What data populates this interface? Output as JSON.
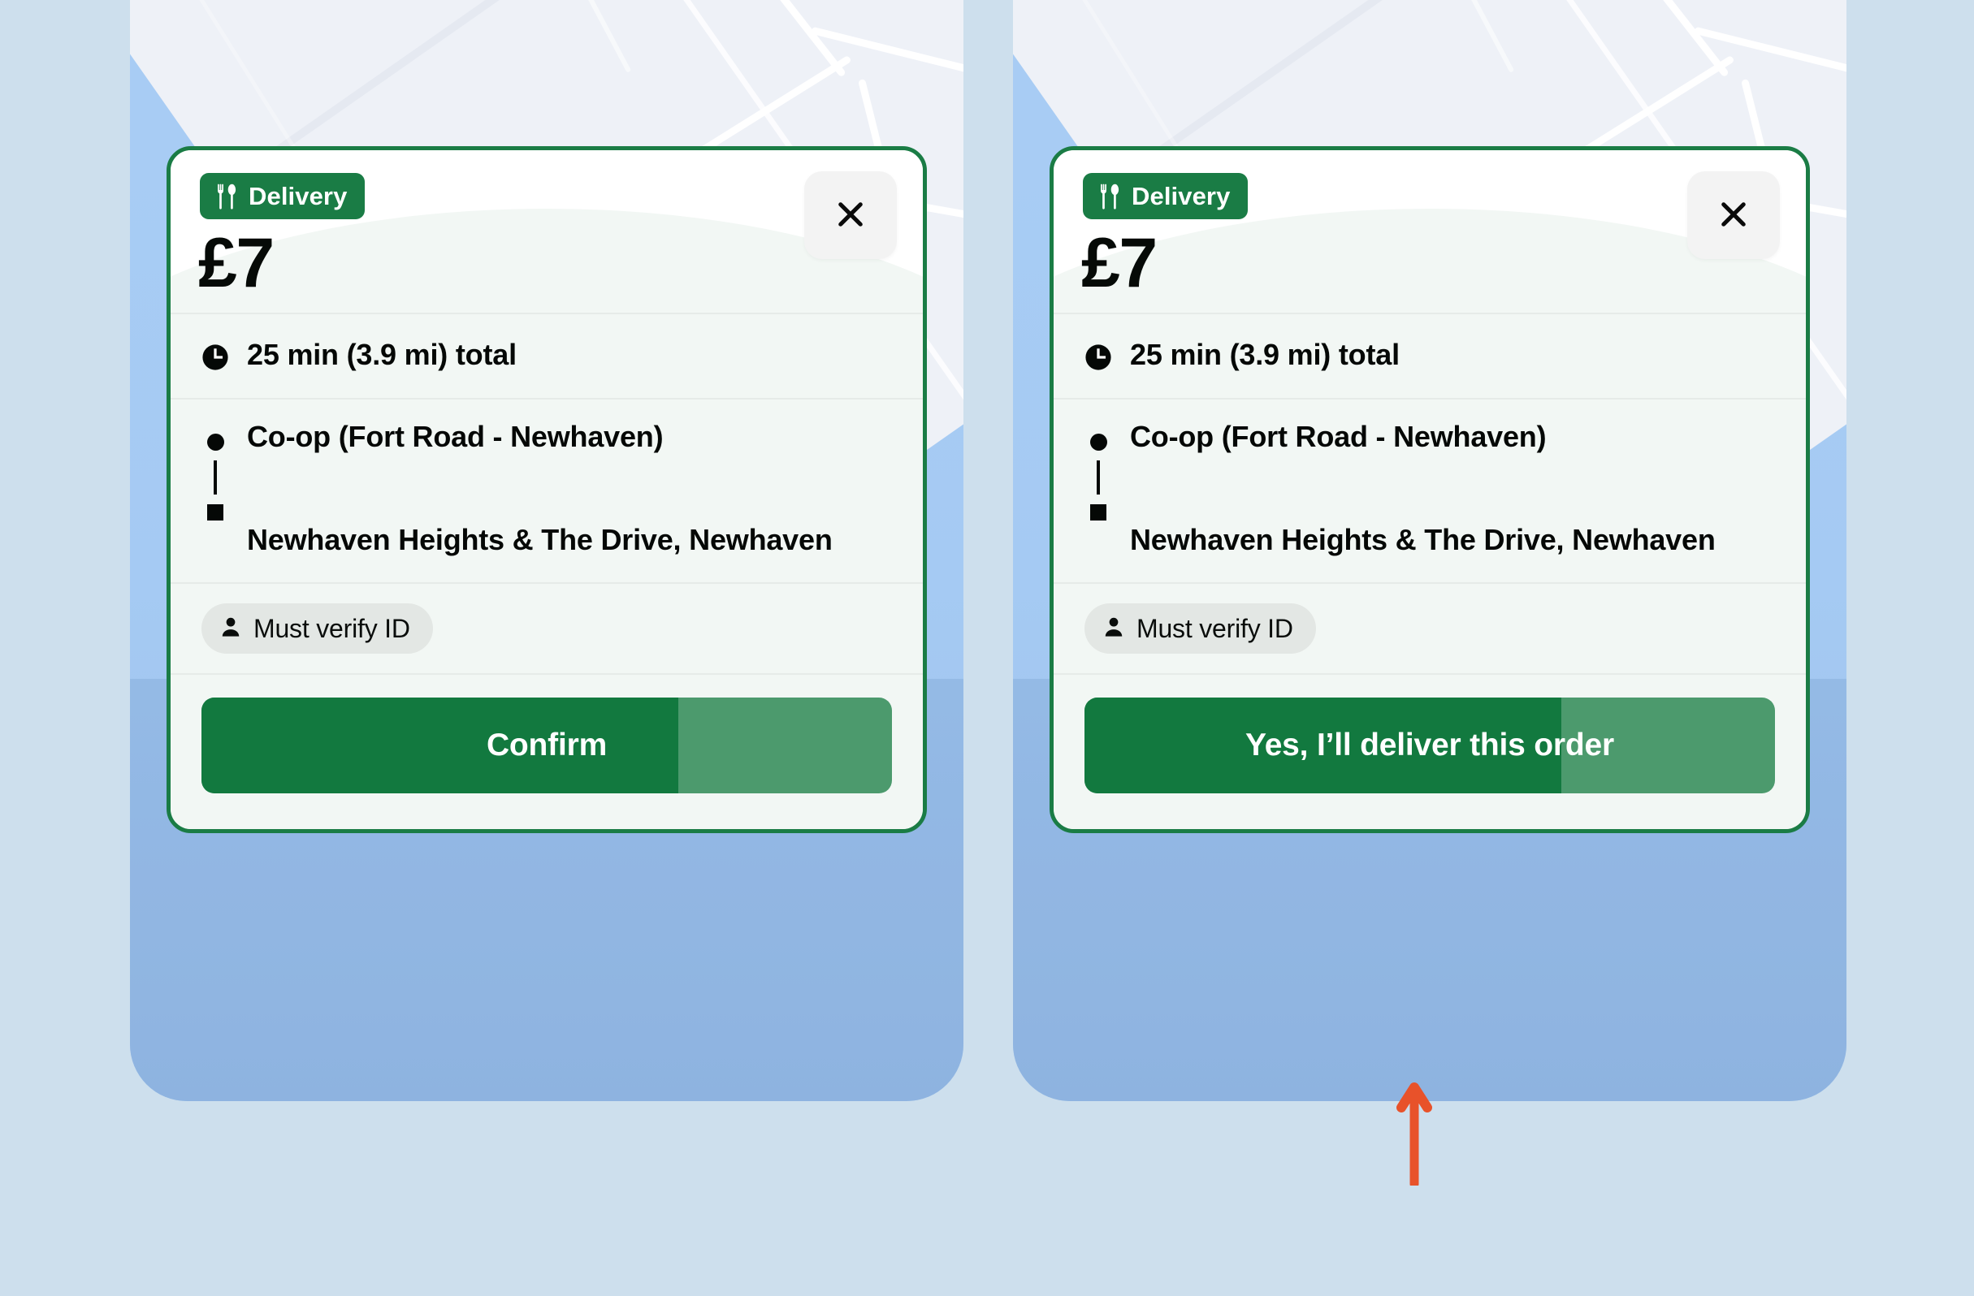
{
  "colors": {
    "page_background": "#cddfed",
    "map_water": "#a7cdf5",
    "map_land": "#eef1f7",
    "brand_green": "#1a7c45",
    "button_fill": "#12793f",
    "button_track": "#4c9a6d",
    "card_body": "#f2f7f4",
    "chip_background": "#e3e7e4",
    "annotation_arrow": "#e8522a"
  },
  "panels": [
    {
      "id": "before",
      "card": {
        "badge": {
          "label": "Delivery",
          "icon": "cutlery-icon"
        },
        "price": "£7",
        "close": {
          "icon": "close-icon",
          "label": "Close"
        },
        "summary": {
          "icon": "clock-icon",
          "text": "25 min (3.9 mi) total"
        },
        "route": {
          "pickup_marker": "circle-marker-icon",
          "dropoff_marker": "square-marker-icon",
          "pickup": "Co-op (Fort Road - Newhaven)",
          "dropoff": "Newhaven Heights & The Drive, Newhaven"
        },
        "chip": {
          "icon": "person-icon",
          "label": "Must verify ID"
        },
        "action": {
          "label": "Confirm",
          "progress_percent": 69
        }
      }
    },
    {
      "id": "after",
      "card": {
        "badge": {
          "label": "Delivery",
          "icon": "cutlery-icon"
        },
        "price": "£7",
        "close": {
          "icon": "close-icon",
          "label": "Close"
        },
        "summary": {
          "icon": "clock-icon",
          "text": "25 min (3.9 mi) total"
        },
        "route": {
          "pickup_marker": "circle-marker-icon",
          "dropoff_marker": "square-marker-icon",
          "pickup": "Co-op (Fort Road - Newhaven)",
          "dropoff": "Newhaven Heights & The Drive, Newhaven"
        },
        "chip": {
          "icon": "person-icon",
          "label": "Must verify ID"
        },
        "action": {
          "label": "Yes, I’ll deliver this order",
          "progress_percent": 69
        }
      }
    }
  ],
  "annotation": {
    "icon": "up-arrow-icon",
    "points_at": "after-panel-action-button"
  }
}
